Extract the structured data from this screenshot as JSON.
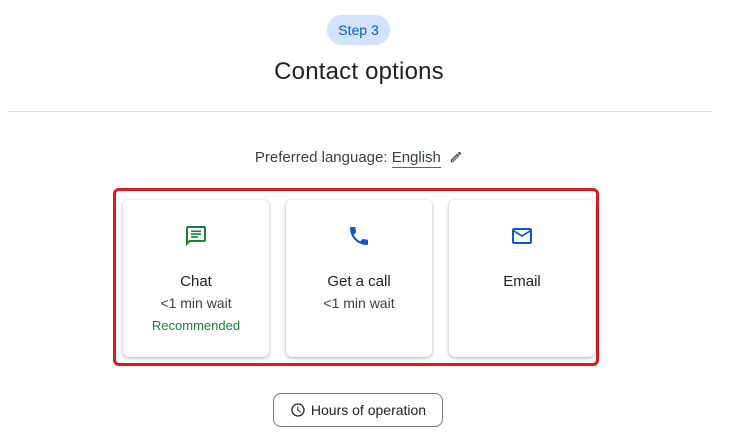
{
  "step": {
    "label": "Step 3"
  },
  "page": {
    "title": "Contact options"
  },
  "language": {
    "prefix": "Preferred language:",
    "value": "English"
  },
  "options": [
    {
      "icon": "chat-icon",
      "title": "Chat",
      "wait": "<1 min wait",
      "badge": "Recommended"
    },
    {
      "icon": "phone-icon",
      "title": "Get a call",
      "wait": "<1 min wait",
      "badge": ""
    },
    {
      "icon": "email-icon",
      "title": "Email",
      "wait": "",
      "badge": ""
    }
  ],
  "hours_button": {
    "label": "Hours of operation",
    "icon": "clock-icon"
  },
  "colors": {
    "accent": "#0b57d0",
    "chat_green": "#188038",
    "highlight_red": "#e3161b",
    "badge_bg": "#d3e3fd"
  }
}
